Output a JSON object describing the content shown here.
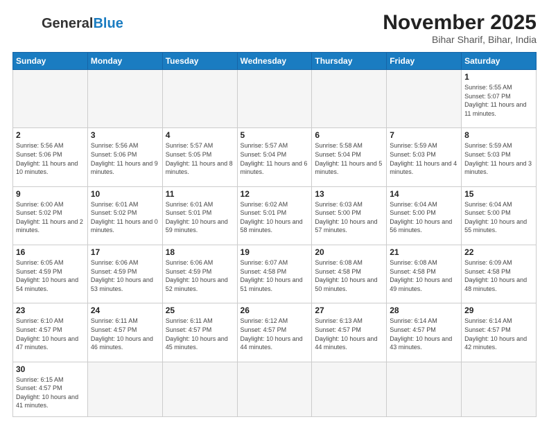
{
  "logo": {
    "general": "General",
    "blue": "Blue"
  },
  "header": {
    "title": "November 2025",
    "subtitle": "Bihar Sharif, Bihar, India"
  },
  "weekdays": [
    "Sunday",
    "Monday",
    "Tuesday",
    "Wednesday",
    "Thursday",
    "Friday",
    "Saturday"
  ],
  "days": {
    "1": {
      "sunrise": "5:55 AM",
      "sunset": "5:07 PM",
      "daylight": "11 hours and 11 minutes."
    },
    "2": {
      "sunrise": "5:56 AM",
      "sunset": "5:06 PM",
      "daylight": "11 hours and 10 minutes."
    },
    "3": {
      "sunrise": "5:56 AM",
      "sunset": "5:06 PM",
      "daylight": "11 hours and 9 minutes."
    },
    "4": {
      "sunrise": "5:57 AM",
      "sunset": "5:05 PM",
      "daylight": "11 hours and 8 minutes."
    },
    "5": {
      "sunrise": "5:57 AM",
      "sunset": "5:04 PM",
      "daylight": "11 hours and 6 minutes."
    },
    "6": {
      "sunrise": "5:58 AM",
      "sunset": "5:04 PM",
      "daylight": "11 hours and 5 minutes."
    },
    "7": {
      "sunrise": "5:59 AM",
      "sunset": "5:03 PM",
      "daylight": "11 hours and 4 minutes."
    },
    "8": {
      "sunrise": "5:59 AM",
      "sunset": "5:03 PM",
      "daylight": "11 hours and 3 minutes."
    },
    "9": {
      "sunrise": "6:00 AM",
      "sunset": "5:02 PM",
      "daylight": "11 hours and 2 minutes."
    },
    "10": {
      "sunrise": "6:01 AM",
      "sunset": "5:02 PM",
      "daylight": "11 hours and 0 minutes."
    },
    "11": {
      "sunrise": "6:01 AM",
      "sunset": "5:01 PM",
      "daylight": "10 hours and 59 minutes."
    },
    "12": {
      "sunrise": "6:02 AM",
      "sunset": "5:01 PM",
      "daylight": "10 hours and 58 minutes."
    },
    "13": {
      "sunrise": "6:03 AM",
      "sunset": "5:00 PM",
      "daylight": "10 hours and 57 minutes."
    },
    "14": {
      "sunrise": "6:04 AM",
      "sunset": "5:00 PM",
      "daylight": "10 hours and 56 minutes."
    },
    "15": {
      "sunrise": "6:04 AM",
      "sunset": "5:00 PM",
      "daylight": "10 hours and 55 minutes."
    },
    "16": {
      "sunrise": "6:05 AM",
      "sunset": "4:59 PM",
      "daylight": "10 hours and 54 minutes."
    },
    "17": {
      "sunrise": "6:06 AM",
      "sunset": "4:59 PM",
      "daylight": "10 hours and 53 minutes."
    },
    "18": {
      "sunrise": "6:06 AM",
      "sunset": "4:59 PM",
      "daylight": "10 hours and 52 minutes."
    },
    "19": {
      "sunrise": "6:07 AM",
      "sunset": "4:58 PM",
      "daylight": "10 hours and 51 minutes."
    },
    "20": {
      "sunrise": "6:08 AM",
      "sunset": "4:58 PM",
      "daylight": "10 hours and 50 minutes."
    },
    "21": {
      "sunrise": "6:08 AM",
      "sunset": "4:58 PM",
      "daylight": "10 hours and 49 minutes."
    },
    "22": {
      "sunrise": "6:09 AM",
      "sunset": "4:58 PM",
      "daylight": "10 hours and 48 minutes."
    },
    "23": {
      "sunrise": "6:10 AM",
      "sunset": "4:57 PM",
      "daylight": "10 hours and 47 minutes."
    },
    "24": {
      "sunrise": "6:11 AM",
      "sunset": "4:57 PM",
      "daylight": "10 hours and 46 minutes."
    },
    "25": {
      "sunrise": "6:11 AM",
      "sunset": "4:57 PM",
      "daylight": "10 hours and 45 minutes."
    },
    "26": {
      "sunrise": "6:12 AM",
      "sunset": "4:57 PM",
      "daylight": "10 hours and 44 minutes."
    },
    "27": {
      "sunrise": "6:13 AM",
      "sunset": "4:57 PM",
      "daylight": "10 hours and 44 minutes."
    },
    "28": {
      "sunrise": "6:14 AM",
      "sunset": "4:57 PM",
      "daylight": "10 hours and 43 minutes."
    },
    "29": {
      "sunrise": "6:14 AM",
      "sunset": "4:57 PM",
      "daylight": "10 hours and 42 minutes."
    },
    "30": {
      "sunrise": "6:15 AM",
      "sunset": "4:57 PM",
      "daylight": "10 hours and 41 minutes."
    }
  }
}
